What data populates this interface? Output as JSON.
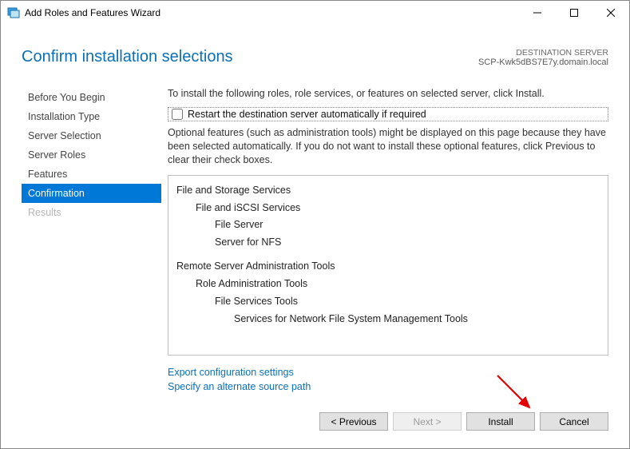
{
  "titlebar": {
    "title": "Add Roles and Features Wizard"
  },
  "header": {
    "page_title": "Confirm installation selections",
    "server_label": "DESTINATION SERVER",
    "server_name": "SCP-Kwk5dBS7E7y.domain.local"
  },
  "sidebar": {
    "items": [
      {
        "label": "Before You Begin",
        "state": "normal"
      },
      {
        "label": "Installation Type",
        "state": "normal"
      },
      {
        "label": "Server Selection",
        "state": "normal"
      },
      {
        "label": "Server Roles",
        "state": "normal"
      },
      {
        "label": "Features",
        "state": "normal"
      },
      {
        "label": "Confirmation",
        "state": "active"
      },
      {
        "label": "Results",
        "state": "disabled"
      }
    ]
  },
  "main": {
    "intro": "To install the following roles, role services, or features on selected server, click Install.",
    "restart_checkbox_label": "Restart the destination server automatically if required",
    "restart_checked": false,
    "optional_text": "Optional features (such as administration tools) might be displayed on this page because they have been selected automatically. If you do not want to install these optional features, click Previous to clear their check boxes.",
    "tree": {
      "group1": {
        "l1": "File and Storage Services",
        "l2": "File and iSCSI Services",
        "l3a": "File Server",
        "l3b": "Server for NFS"
      },
      "group2": {
        "l1": "Remote Server Administration Tools",
        "l2": "Role Administration Tools",
        "l3": "File Services Tools",
        "l4": "Services for Network File System Management Tools"
      }
    },
    "links": {
      "export": "Export configuration settings",
      "source": "Specify an alternate source path"
    }
  },
  "footer": {
    "previous": "< Previous",
    "next": "Next >",
    "install": "Install",
    "cancel": "Cancel"
  }
}
